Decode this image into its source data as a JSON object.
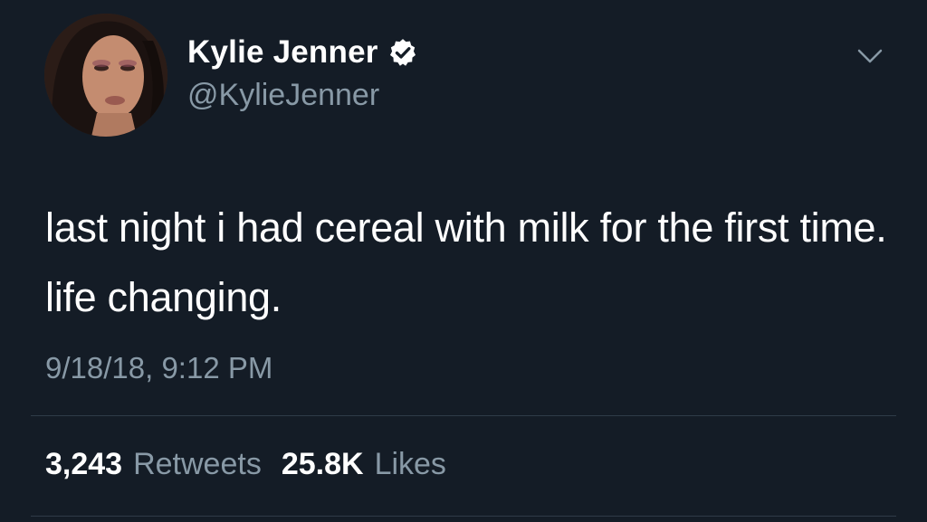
{
  "tweet": {
    "author": {
      "display_name": "Kylie Jenner",
      "handle": "@KylieJenner",
      "verified": true
    },
    "text": "last night i had cereal with milk for the first time. life changing.",
    "timestamp": "9/18/18, 9:12 PM",
    "stats": {
      "retweets_count": "3,243",
      "retweets_label": "Retweets",
      "likes_count": "25.8K",
      "likes_label": "Likes"
    },
    "icons": {
      "verified": "verified-badge-icon",
      "menu": "chevron-down-icon"
    }
  },
  "colors": {
    "background": "#141c26",
    "primary_text": "#ffffff",
    "secondary_text": "#8899a6",
    "divider": "#2f3b48"
  }
}
